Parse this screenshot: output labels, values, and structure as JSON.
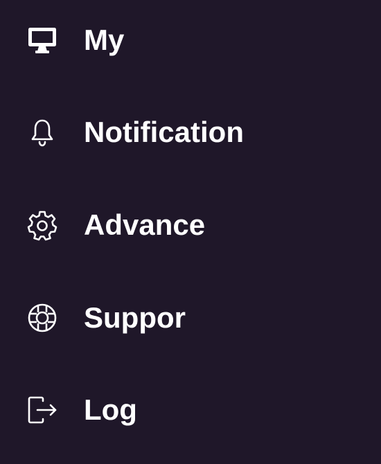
{
  "colors": {
    "background": "#1f1729",
    "text": "#ffffff"
  },
  "menu": {
    "items": [
      {
        "label": "My",
        "icon": "monitor-icon"
      },
      {
        "label": "Notification",
        "icon": "bell-icon"
      },
      {
        "label": "Advance",
        "icon": "gear-icon"
      },
      {
        "label": "Suppor",
        "icon": "lifebuoy-icon"
      },
      {
        "label": "Log",
        "icon": "logout-icon"
      }
    ]
  }
}
